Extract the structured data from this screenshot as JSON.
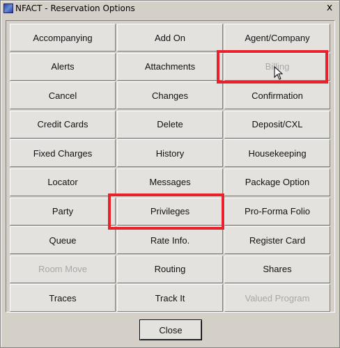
{
  "window": {
    "title": "NFACT - Reservation Options",
    "close_glyph": "x"
  },
  "options": [
    {
      "label": "Accompanying",
      "enabled": true
    },
    {
      "label": "Add On",
      "enabled": true
    },
    {
      "label": "Agent/Company",
      "enabled": true
    },
    {
      "label": "Alerts",
      "enabled": true
    },
    {
      "label": "Attachments",
      "enabled": true
    },
    {
      "label": "Billing",
      "enabled": false
    },
    {
      "label": "Cancel",
      "enabled": true
    },
    {
      "label": "Changes",
      "enabled": true
    },
    {
      "label": "Confirmation",
      "enabled": true
    },
    {
      "label": "Credit Cards",
      "enabled": true
    },
    {
      "label": "Delete",
      "enabled": true
    },
    {
      "label": "Deposit/CXL",
      "enabled": true
    },
    {
      "label": "Fixed Charges",
      "enabled": true
    },
    {
      "label": "History",
      "enabled": true
    },
    {
      "label": "Housekeeping",
      "enabled": true
    },
    {
      "label": "Locator",
      "enabled": true
    },
    {
      "label": "Messages",
      "enabled": true
    },
    {
      "label": "Package Option",
      "enabled": true
    },
    {
      "label": "Party",
      "enabled": true
    },
    {
      "label": "Privileges",
      "enabled": true
    },
    {
      "label": "Pro-Forma Folio",
      "enabled": true
    },
    {
      "label": "Queue",
      "enabled": true
    },
    {
      "label": "Rate Info.",
      "enabled": true
    },
    {
      "label": "Register Card",
      "enabled": true
    },
    {
      "label": "Room Move",
      "enabled": false
    },
    {
      "label": "Routing",
      "enabled": true
    },
    {
      "label": "Shares",
      "enabled": true
    },
    {
      "label": "Traces",
      "enabled": true
    },
    {
      "label": "Track It",
      "enabled": true
    },
    {
      "label": "Valued Program",
      "enabled": false
    }
  ],
  "footer": {
    "close_label": "Close"
  },
  "colors": {
    "highlight": "#e8212b",
    "disabled_text": "#a8a8a8"
  }
}
